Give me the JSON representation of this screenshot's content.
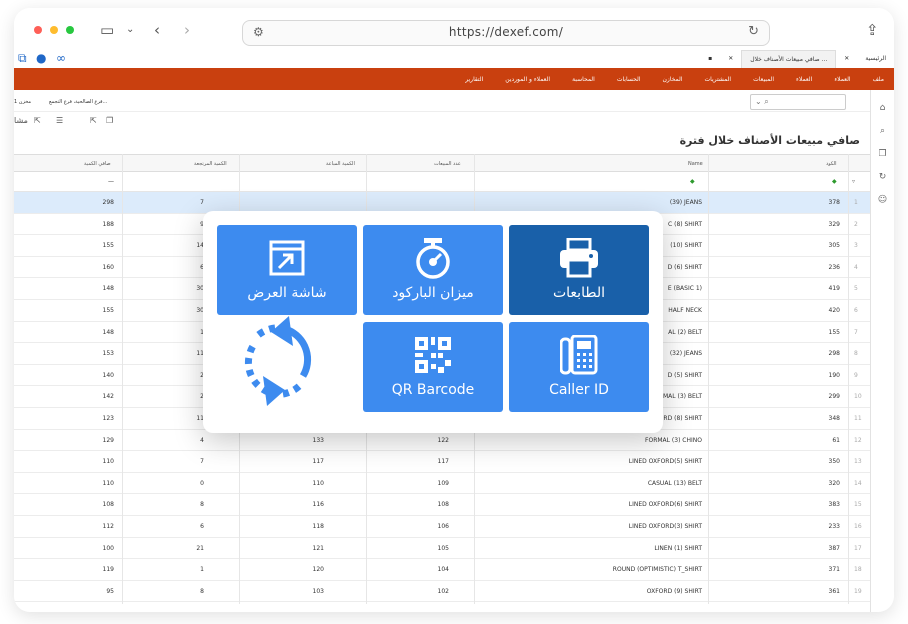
{
  "browser": {
    "url": "https://dexef.com/"
  },
  "app": {
    "tabs": [
      "الرئيسية",
      "صافي مبيعات الأصناف خلال ..."
    ],
    "menu": [
      "ملف",
      "العملاء",
      "العملاء",
      "المبيعات",
      "المشتريات",
      "المخازن",
      "الحسابات",
      "المحاسبة",
      "العملاء و الموردين",
      "التقارير"
    ],
    "filters": {
      "branch": "فرع الصالحية، فرع التجمع...",
      "store": "مخزن 1"
    },
    "toolbar_label": "مشا",
    "report_title": "صافي مبيعات الأصناف خلال فترة",
    "columns": {
      "code": "الكود",
      "name": "Name",
      "sold_count": "عدد المبيعات",
      "sold_qty": "الكمية المباعة",
      "returned_qty": "الكمية المرتجعة",
      "net_qty": "صافي الكمية"
    },
    "rows": [
      {
        "code": "378",
        "name": "(39) JEANS",
        "sold": "",
        "qty": "",
        "ret": "7",
        "net": "298"
      },
      {
        "code": "329",
        "name": "C (8) SHIRT",
        "sold": "",
        "qty": "",
        "ret": "9",
        "net": "188"
      },
      {
        "code": "305",
        "name": "(10) SHIRT",
        "sold": "",
        "qty": "",
        "ret": "14",
        "net": "155"
      },
      {
        "code": "236",
        "name": "D (6) SHIRT",
        "sold": "",
        "qty": "",
        "ret": "6",
        "net": "160"
      },
      {
        "code": "419",
        "name": "E (BASIC 1)",
        "sold": "",
        "qty": "",
        "ret": "30",
        "net": "148"
      },
      {
        "code": "420",
        "name": "HALF NECK",
        "sold": "",
        "qty": "",
        "ret": "30",
        "net": "155"
      },
      {
        "code": "155",
        "name": "AL (2) BELT",
        "sold": "",
        "qty": "",
        "ret": "1",
        "net": "148"
      },
      {
        "code": "298",
        "name": "(32) JEANS",
        "sold": "",
        "qty": "",
        "ret": "11",
        "net": "153"
      },
      {
        "code": "190",
        "name": "D (5) SHIRT",
        "sold": "",
        "qty": "",
        "ret": "2",
        "net": "140"
      },
      {
        "code": "299",
        "name": "FORMAL (3) BELT",
        "sold": "135",
        "qty": "144",
        "ret": "2",
        "net": "142"
      },
      {
        "code": "348",
        "name": "OXFORD (8) SHIRT",
        "sold": "134",
        "qty": "134",
        "ret": "11",
        "net": "123"
      },
      {
        "code": "61",
        "name": "FORMAL (3) CHINO",
        "sold": "122",
        "qty": "133",
        "ret": "4",
        "net": "129"
      },
      {
        "code": "350",
        "name": "LINED OXFORD(5) SHIRT",
        "sold": "117",
        "qty": "117",
        "ret": "7",
        "net": "110"
      },
      {
        "code": "320",
        "name": "CASUAL (13) BELT",
        "sold": "109",
        "qty": "110",
        "ret": "0",
        "net": "110"
      },
      {
        "code": "383",
        "name": "LINED OXFORD(6) SHIRT",
        "sold": "108",
        "qty": "116",
        "ret": "8",
        "net": "108"
      },
      {
        "code": "233",
        "name": "LINED OXFORD(3) SHIRT",
        "sold": "106",
        "qty": "118",
        "ret": "6",
        "net": "112"
      },
      {
        "code": "387",
        "name": "LINEN (1) SHIRT",
        "sold": "105",
        "qty": "121",
        "ret": "21",
        "net": "100"
      },
      {
        "code": "371",
        "name": "ROUND (OPTIMISTIC) T_SHIRT",
        "sold": "104",
        "qty": "120",
        "ret": "1",
        "net": "119"
      },
      {
        "code": "361",
        "name": "OXFORD (9) SHIRT",
        "sold": "102",
        "qty": "103",
        "ret": "8",
        "net": "95"
      }
    ]
  },
  "overlay": {
    "tiles": {
      "printers": "الطابعات",
      "scale": "ميزان الباركود",
      "display": "شاشة العرض",
      "caller_id": "Caller ID",
      "qr": "QR Barcode"
    }
  },
  "colors": {
    "menu_bar": "#c9400f",
    "tile_blue": "#3d8bef",
    "tile_dark": "#1960a9"
  }
}
